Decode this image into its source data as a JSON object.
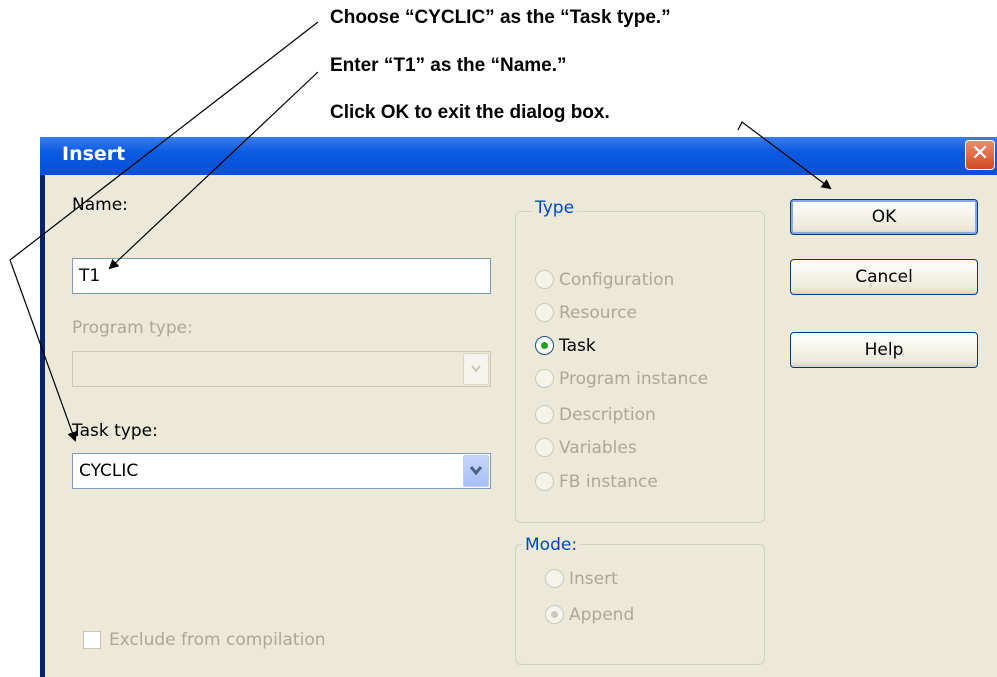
{
  "callouts": {
    "task_type": "Choose “CYCLIC” as the “Task type.”",
    "name": "Enter “T1” as the “Name.”",
    "ok": "Click OK to exit the dialog box."
  },
  "dialog": {
    "title": "Insert",
    "close_glyph": "✕",
    "name_label": "Name:",
    "name_value": "T1",
    "program_type_label": "Program type:",
    "program_type_value": "",
    "task_type_label": "Task type:",
    "task_type_value": "CYCLIC",
    "exclude_label": "Exclude from compilation",
    "type_group": {
      "title": "Type",
      "options": [
        "Configuration",
        "Resource",
        "Task",
        "Program instance",
        "Description",
        "Variables",
        "FB instance"
      ],
      "selected": "Task"
    },
    "mode_group": {
      "title": "Mode:",
      "options": [
        "Insert",
        "Append"
      ],
      "selected": "Append"
    },
    "buttons": {
      "ok": "OK",
      "cancel": "Cancel",
      "help": "Help"
    }
  },
  "icons": {
    "close": "close-icon",
    "dropdown": "chevron-down-icon"
  }
}
